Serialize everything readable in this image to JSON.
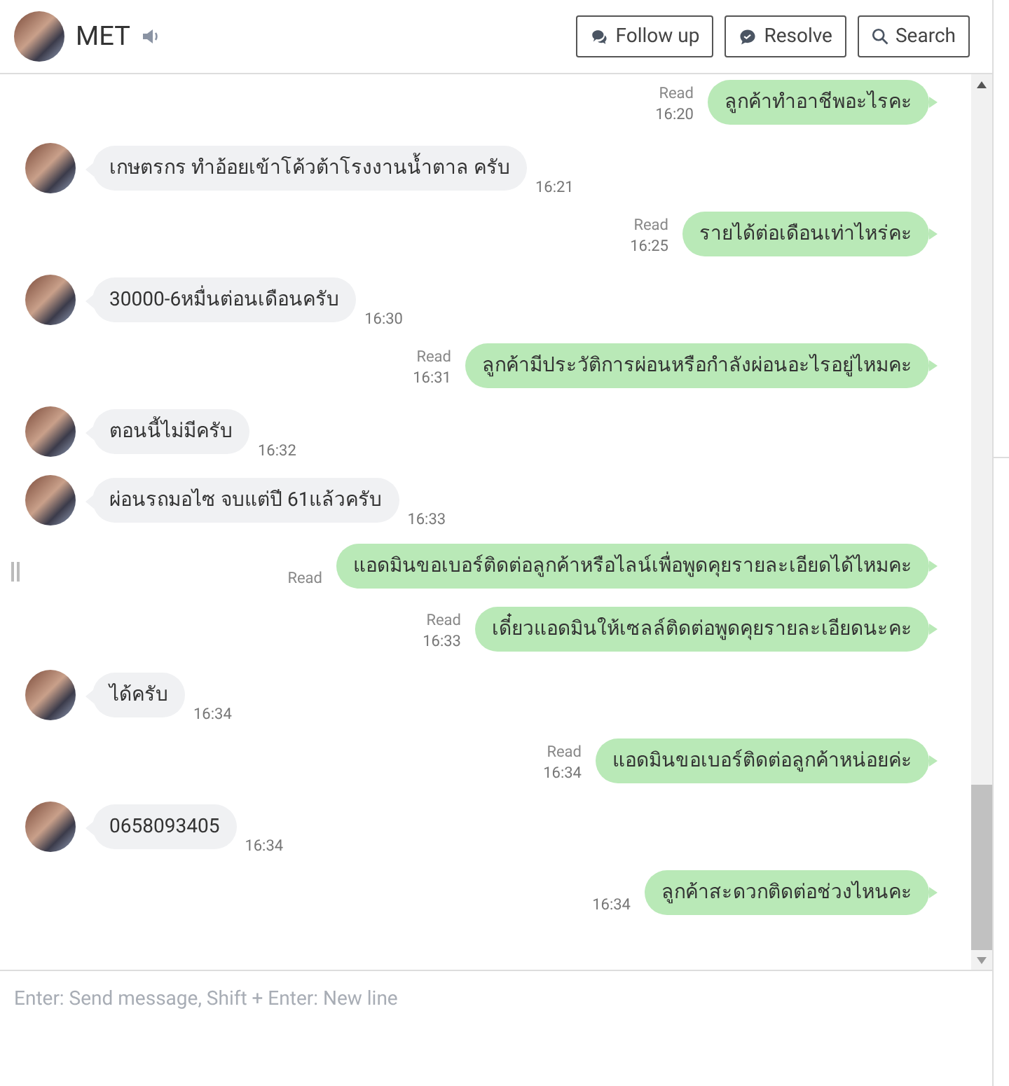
{
  "header": {
    "name": "MET",
    "buttons": [
      {
        "label": "Follow up",
        "kind": "followup"
      },
      {
        "label": "Resolve",
        "kind": "resolve"
      },
      {
        "label": "Search",
        "kind": "search"
      }
    ]
  },
  "messages": [
    {
      "kind": "out",
      "text": "ลูกค้าทำอาชีพอะไรคะ",
      "status": "Read",
      "time": "16:20"
    },
    {
      "kind": "in",
      "text": "เกษตรกร  ทำอ้อยเข้าโค้วต้าโรงงานน้ำตาล ครับ",
      "time": "16:21"
    },
    {
      "kind": "out",
      "text": "รายได้ต่อเดือนเท่าไหร่คะ",
      "status": "Read",
      "time": "16:25"
    },
    {
      "kind": "in",
      "text": "30000-6หมื่นต่อนเดือนครับ",
      "time": "16:30"
    },
    {
      "kind": "out",
      "text": "ลูกค้ามีประวัติการผ่อนหรือกำลังผ่อนอะไรอยู่ไหมคะ",
      "status": "Read",
      "time": "16:31"
    },
    {
      "kind": "in",
      "text": "ตอนนี้ไม่มีครับ",
      "time": "16:32"
    },
    {
      "kind": "in",
      "text": "ผ่อนรถมอไซ จบแต่ปี 61แล้วครับ",
      "time": "16:33"
    },
    {
      "kind": "out",
      "text": "แอดมินขอเบอร์ติดต่อลูกค้าหรือไลน์เพื่อพูดคุยรายละเอียดได้ไหมคะ",
      "status": "Read"
    },
    {
      "kind": "out",
      "text": "เดี๋ยวแอดมินให้เซลล์ติดต่อพูดคุยรายละเอียดนะคะ",
      "status": "Read",
      "time": "16:33"
    },
    {
      "kind": "in",
      "text": "ได้ครับ",
      "time": "16:34"
    },
    {
      "kind": "out",
      "text": "แอดมินขอเบอร์ติดต่อลูกค้าหน่อยค่ะ",
      "status": "Read",
      "time": "16:34"
    },
    {
      "kind": "in",
      "text": "0658093405",
      "time": "16:34"
    },
    {
      "kind": "out",
      "text": "ลูกค้าสะดวกติดต่อช่วงไหนคะ",
      "time": "16:34"
    }
  ],
  "composer": {
    "placeholder": "Enter: Send message, Shift + Enter: New line"
  }
}
